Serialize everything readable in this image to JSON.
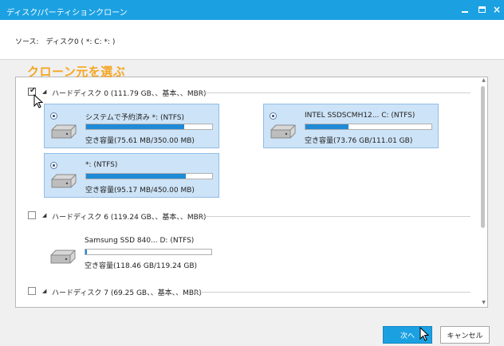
{
  "window": {
    "title": "ディスク/パーティションクローン",
    "minimize_label": "",
    "maximize_label": "",
    "close_label": "×"
  },
  "source": {
    "text": "ソース:　ディスク0 ( *: C: *: )"
  },
  "overlay_title": "クローン元を選ぶ",
  "disks": [
    {
      "label": "ハードディスク 0 (111.79 GB、、基本、、MBR)",
      "checked": true,
      "partitions": [
        {
          "name": "システムで予約済み *: (NTFS)",
          "free": "空き容量(75.61 MB/350.00 MB)",
          "usage_fraction": 0.78,
          "selected": true
        },
        {
          "name": "INTEL SSDSCMH12... C: (NTFS)",
          "free": "空き容量(73.76 GB/111.01 GB)",
          "usage_fraction": 0.34,
          "selected": true
        },
        {
          "name": "*: (NTFS)",
          "free": "空き容量(95.17 MB/450.00 MB)",
          "usage_fraction": 0.79,
          "selected": true
        }
      ]
    },
    {
      "label": "ハードディスク 6 (119.24 GB、、基本、、MBR)",
      "checked": false,
      "partitions": [
        {
          "name": "Samsung SSD 840... D: (NTFS)",
          "free": "空き容量(118.46 GB/119.24 GB)",
          "usage_fraction": 0.01,
          "selected": false
        }
      ]
    },
    {
      "label": "ハードディスク 7 (69.25 GB、、基本、、MBR)",
      "checked": false,
      "partitions": []
    }
  ],
  "buttons": {
    "next": "次へ",
    "cancel": "キャンセル"
  },
  "colors": {
    "accent": "#1ba1e2",
    "overlay_title": "#f5a623",
    "selected_partition": "#cde3f7",
    "bar_fill": "#1f8ad6"
  }
}
